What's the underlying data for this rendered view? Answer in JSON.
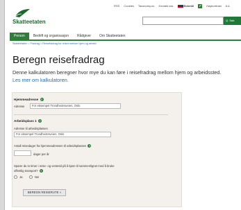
{
  "utility": {
    "rss": "RSS",
    "cookies": "Cookies",
    "taxonomy": "Taxonomy.no",
    "contact": "Kontakt oss",
    "language": "Bokmål",
    "accessibility": "Høykontrast",
    "text_size": "A A"
  },
  "brand": {
    "name": "Skatteetaten"
  },
  "search": {
    "placeholder": "",
    "button_label": "Q. Søk"
  },
  "nav": {
    "items": [
      {
        "label": "Person",
        "active": true
      },
      {
        "label": "Bedrift og organisasjon",
        "active": false
      },
      {
        "label": "Rådgiver",
        "active": false
      },
      {
        "label": "Om Skatteetaten",
        "active": false
      }
    ]
  },
  "breadcrumb": "Skatteetaten > Fradrag > Reisefradrag for reiser mellom hjem og arbeid",
  "page": {
    "title": "Beregn reisefradrag",
    "intro": "Denne kalkulatoren beregner hvor mye du kan føre i reisefradrag mellom hjem og arbeidssted.",
    "more_link": "Les mer om kalkulatoren."
  },
  "form": {
    "home": {
      "heading": "Hjemmeadresse",
      "address_label": "Adresse",
      "address_placeholder": "For eksempel Trondheimsveien, Oslo"
    },
    "workplace": {
      "heading": "Arbeidsplass 1",
      "address_label": "Adresse til arbeidsplassen",
      "address_placeholder": "For eksempel Trondheimsveien, Oslo",
      "trips_label": "Antall reisedager fra hjemmeadressen til arbeidsplassen",
      "trips_unit": "dager per år",
      "question": "Sparer du to timer i reise- og ventetid på å kjøre til sammenlignet med å bruke",
      "question_line2": "offentlig transport?",
      "option_yes": "Ja",
      "option_no": "Nei"
    },
    "submit_label": "BEREGN REISERUTE »"
  },
  "colors": {
    "brand_green": "#2f7d3b",
    "link_blue": "#2a6db1",
    "panel_bg": "#f4f1ec"
  }
}
